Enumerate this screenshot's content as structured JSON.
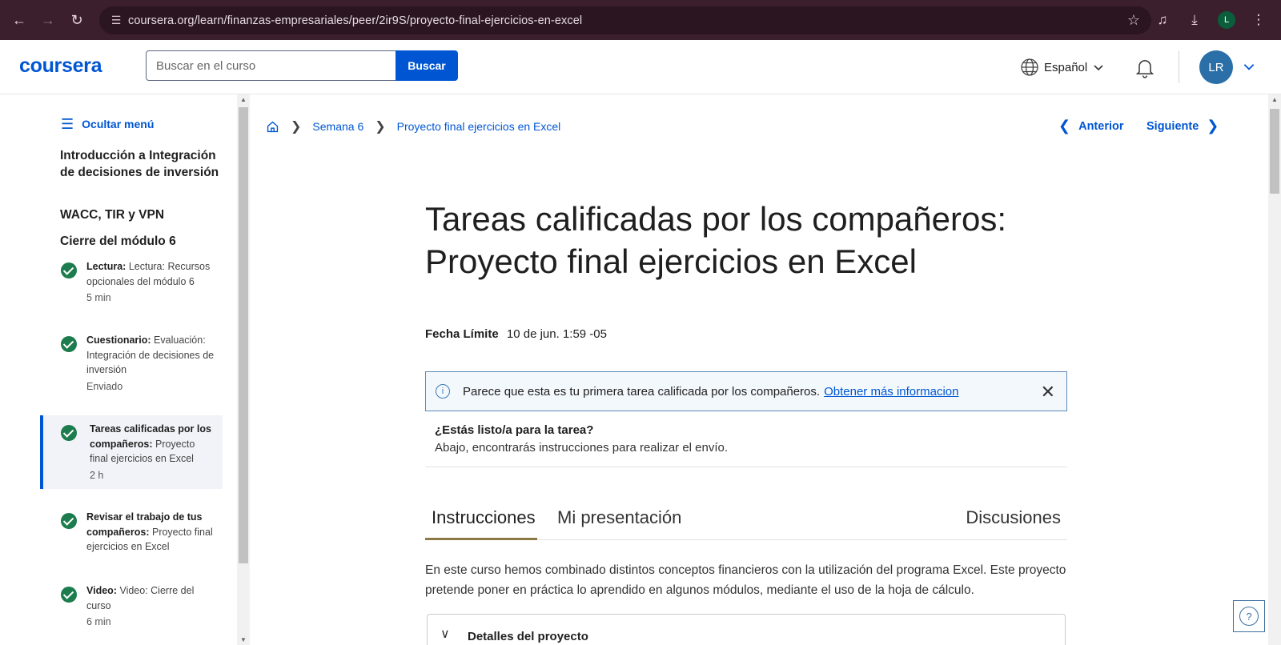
{
  "browser": {
    "url": "coursera.org/learn/finanzas-empresariales/peer/2ir9S/proyecto-final-ejercicios-en-excel",
    "profile_initial": "L"
  },
  "header": {
    "logo": "coursera",
    "search_placeholder": "Buscar en el curso",
    "search_button": "Buscar",
    "language": "Español",
    "avatar_initials": "LR"
  },
  "sidebar": {
    "hide_menu": "Ocultar menú",
    "modules": [
      "Introducción a Integración de decisiones de inversión",
      "WACC, TIR y VPN",
      "Cierre del módulo 6"
    ],
    "items": [
      {
        "type": "Lectura:",
        "title": "Lectura: Recursos opcionales del módulo 6",
        "meta": "5 min"
      },
      {
        "type": "Cuestionario:",
        "title": "Evaluación: Integración de decisiones de inversión",
        "meta": "Enviado"
      },
      {
        "type": "Tareas calificadas por los compañeros:",
        "title": "Proyecto final ejercicios en Excel",
        "meta": "2 h"
      },
      {
        "type": "Revisar el trabajo de tus compañeros:",
        "title": "Proyecto final ejercicios en Excel",
        "meta": ""
      },
      {
        "type": "Video:",
        "title": "Video: Cierre del curso",
        "meta": "6 min"
      }
    ]
  },
  "breadcrumb": {
    "week": "Semana 6",
    "current": "Proyecto final ejercicios en Excel"
  },
  "pager": {
    "previous": "Anterior",
    "next": "Siguiente"
  },
  "main": {
    "title_line1": "Tareas calificadas por los compañeros:",
    "title_line2": "Proyecto final ejercicios en Excel",
    "deadline_label": "Fecha Límite",
    "deadline_value": "10 de jun. 1:59 -05",
    "banner_text": "Parece que esta es tu primera tarea calificada por los compañeros.",
    "banner_link": "Obtener más informacion",
    "ready_question": "¿Estás listo/a para la tarea?",
    "ready_desc": "Abajo, encontrarás instrucciones para realizar el envío.",
    "tabs": [
      "Instrucciones",
      "Mi presentación",
      "Discusiones"
    ],
    "body_text": "En este curso hemos combinado distintos conceptos financieros con la utilización del programa Excel. Este proyecto pretende poner en práctica lo aprendido en algunos módulos, mediante el uso de la hoja de cálculo.",
    "details_label": "Detalles del proyecto"
  },
  "colors": {
    "brand": "#0056d2",
    "success": "#1d7c4d",
    "chrome": "#3c1f2c"
  }
}
